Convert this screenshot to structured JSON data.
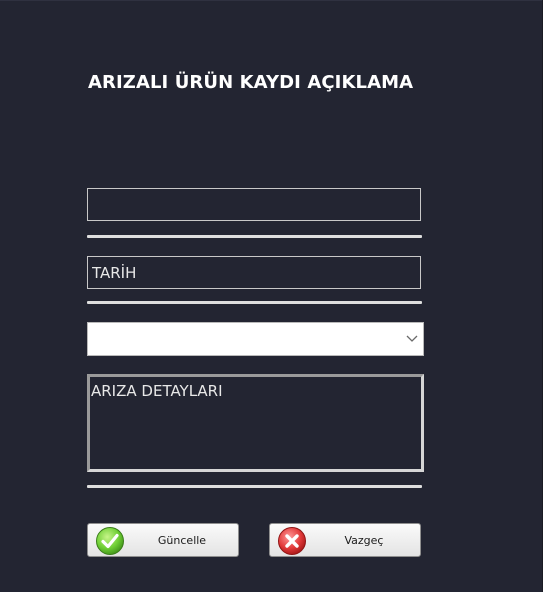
{
  "form": {
    "title": "ARIZALI ÜRÜN KAYDI AÇIKLAMA",
    "field1": {
      "value": "",
      "placeholder": ""
    },
    "date_field": {
      "value": "",
      "placeholder": "TARİH"
    },
    "combo": {
      "selected": ""
    },
    "details": {
      "value": "",
      "placeholder": "ARIZA DETAYLARI"
    }
  },
  "buttons": {
    "update_label": "Güncelle",
    "cancel_label": "Vazgeç"
  },
  "icons": {
    "update": "check-icon",
    "cancel": "x-icon",
    "combo": "chevron-down-icon"
  },
  "colors": {
    "background": "#232532",
    "check_green": "#6fcf35",
    "cancel_red": "#e23a3a"
  }
}
